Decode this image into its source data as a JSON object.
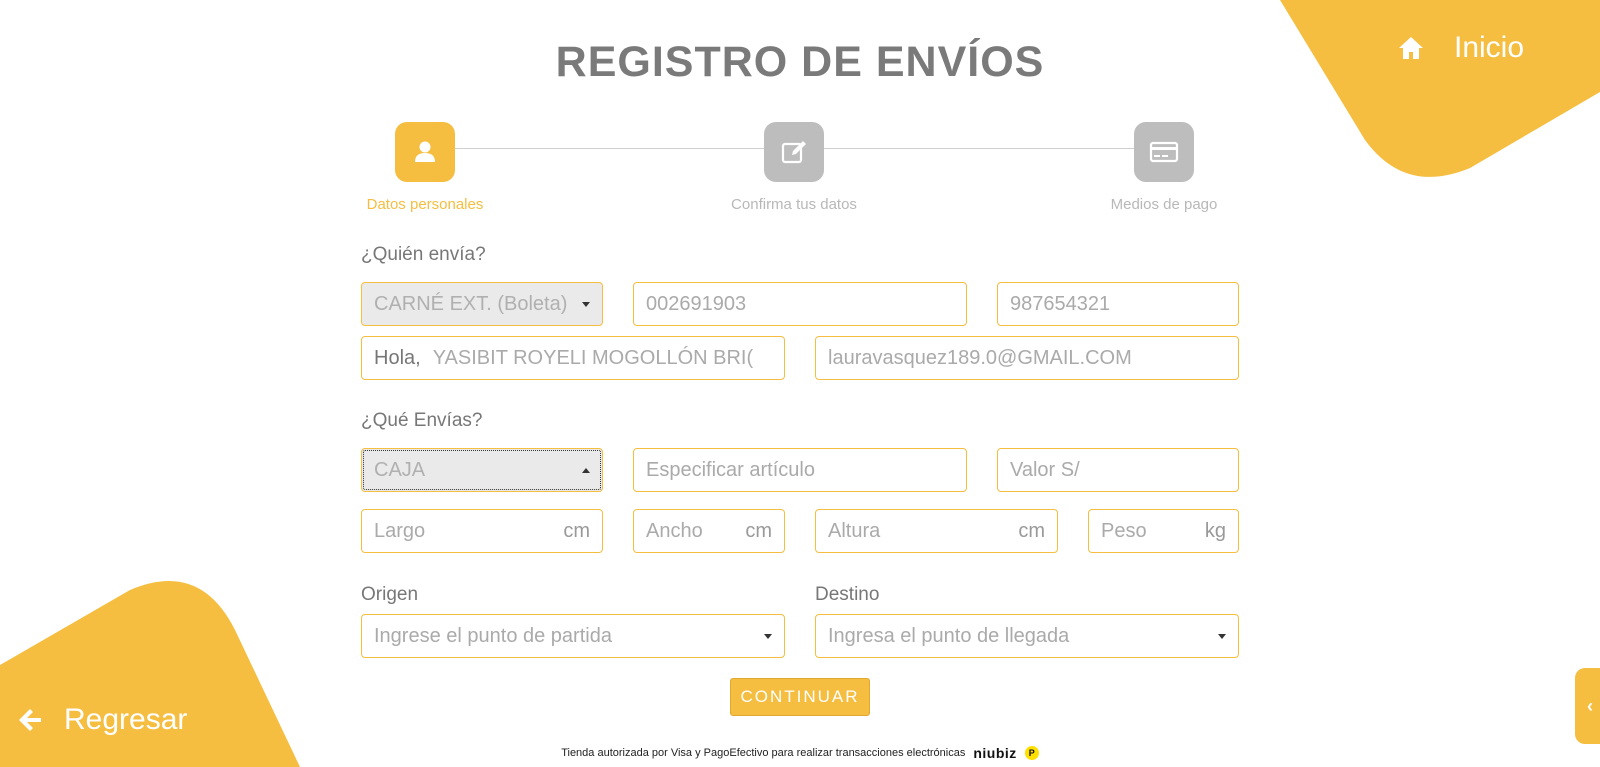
{
  "header": {
    "title": "REGISTRO DE ENVÍOS",
    "home_label": "Inicio",
    "back_label": "Regresar"
  },
  "stepper": [
    {
      "label": "Datos personales",
      "icon": "user-icon",
      "active": true
    },
    {
      "label": "Confirma tus datos",
      "icon": "edit-icon",
      "active": false
    },
    {
      "label": "Medios de pago",
      "icon": "credit-card-icon",
      "active": false
    }
  ],
  "sender": {
    "section_label": "¿Quién envía?",
    "document_type": "CARNÉ EXT. (Boleta)",
    "document_number": "002691903",
    "phone": "987654321",
    "greeting": "Hola,",
    "full_name": "YASIBIT ROYELI MOGOLLÓN BRI(",
    "email": "lauravasquez189.0@GMAIL.COM"
  },
  "package": {
    "section_label": "¿Qué Envías?",
    "type": "CAJA",
    "article_placeholder": "Especificar artículo",
    "value_placeholder": "Valor S/",
    "length_placeholder": "Largo",
    "length_unit": "cm",
    "width_placeholder": "Ancho",
    "width_unit": "cm",
    "height_placeholder": "Altura",
    "height_unit": "cm",
    "weight_placeholder": "Peso",
    "weight_unit": "kg"
  },
  "route": {
    "origin_label": "Origen",
    "origin_placeholder": "Ingrese el punto de partida",
    "destination_label": "Destino",
    "destination_placeholder": "Ingresa el punto de llegada"
  },
  "actions": {
    "continue_label": "CONTINUAR"
  },
  "footer": {
    "text": "Tienda autorizada por Visa y PagoEfectivo para realizar transacciones electrónicas",
    "niubiz": "niubiz",
    "pe_mark": "P"
  },
  "colors": {
    "accent": "#f5be41",
    "inactive_step": "#bdbdbd",
    "text": "#777777"
  }
}
